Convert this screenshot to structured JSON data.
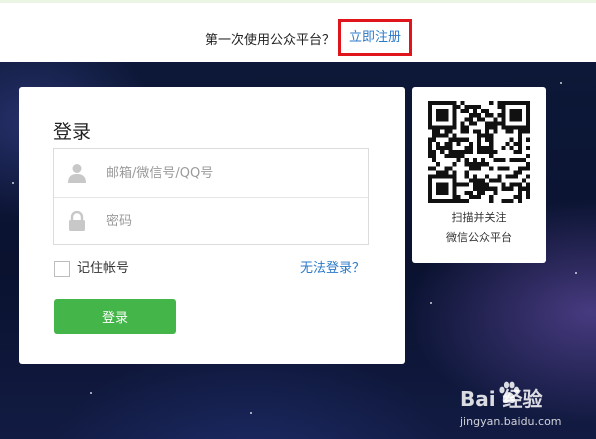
{
  "header": {
    "prompt": "第一次使用公众平台？",
    "register_link": "立即注册",
    "highlight_color": "#e0141b"
  },
  "login": {
    "title": "登录",
    "account_placeholder": "邮箱/微信号/QQ号",
    "password_placeholder": "密码",
    "remember_label": "记住帐号",
    "remember_checked": false,
    "forgot_link": "无法登录？",
    "submit_label": "登录",
    "accent_color": "#44b549"
  },
  "qr": {
    "line1": "扫描并关注",
    "line2": "微信公众平台"
  },
  "watermark": {
    "brand": "Bai 经验",
    "url": "jingyan.baidu.com"
  },
  "icons": [
    "user-icon",
    "lock-icon",
    "qr-code",
    "baidu-paw-icon"
  ]
}
